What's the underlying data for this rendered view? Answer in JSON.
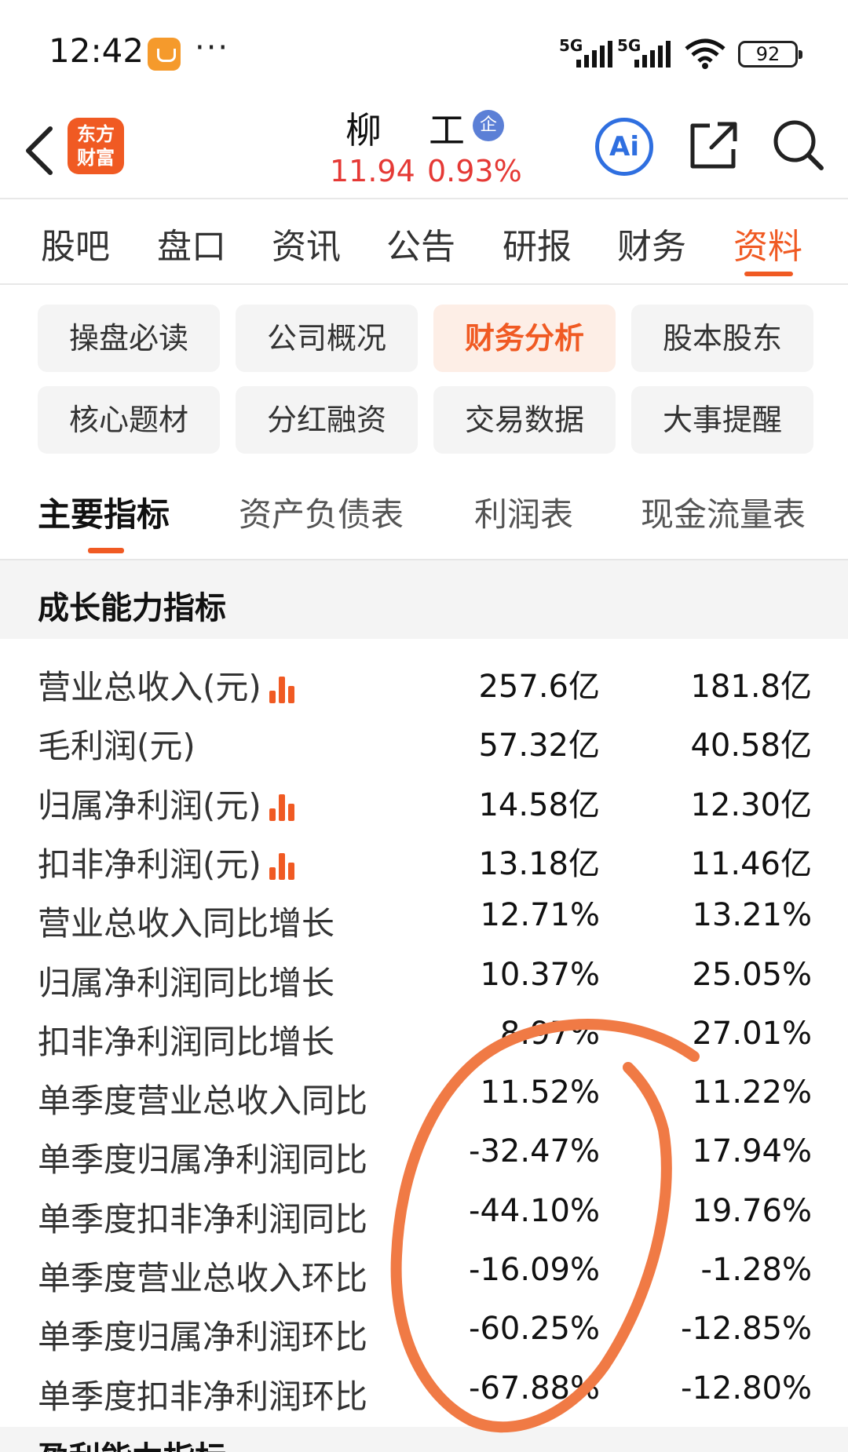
{
  "status_bar": {
    "time": "12:42",
    "more": "···",
    "network1": "5G",
    "network2": "5G",
    "battery": "92"
  },
  "header": {
    "logo_line1": "东方",
    "logo_line2": "财富",
    "stock_name": "柳工",
    "badge": "企",
    "price": "11.94",
    "change": "0.93%",
    "ai_label": "Ai"
  },
  "main_tabs": [
    {
      "label": "股吧"
    },
    {
      "label": "盘口"
    },
    {
      "label": "资讯"
    },
    {
      "label": "公告"
    },
    {
      "label": "研报"
    },
    {
      "label": "财务"
    },
    {
      "label": "资料",
      "active": true
    }
  ],
  "chips": [
    {
      "label": "操盘必读"
    },
    {
      "label": "公司概况"
    },
    {
      "label": "财务分析",
      "active": true
    },
    {
      "label": "股本股东"
    },
    {
      "label": "核心题材"
    },
    {
      "label": "分红融资"
    },
    {
      "label": "交易数据"
    },
    {
      "label": "大事提醒"
    }
  ],
  "sub_tabs": [
    {
      "label": "主要指标",
      "active": true
    },
    {
      "label": "资产负债表"
    },
    {
      "label": "利润表"
    },
    {
      "label": "现金流量表"
    }
  ],
  "section_title": "成长能力指标",
  "rows": [
    {
      "label": "营业总收入(元)",
      "chart": true,
      "v1": "257.6亿",
      "v2": "181.8亿"
    },
    {
      "label": "毛利润(元)",
      "chart": false,
      "v1": "57.32亿",
      "v2": "40.58亿"
    },
    {
      "label": "归属净利润(元)",
      "chart": true,
      "v1": "14.58亿",
      "v2": "12.30亿"
    },
    {
      "label": "扣非净利润(元)",
      "chart": true,
      "v1": "13.18亿",
      "v2": "11.46亿"
    },
    {
      "label": "营业总收入同比增长",
      "chart": false,
      "v1": "12.71%",
      "v2": "13.21%"
    },
    {
      "label": "归属净利润同比增长",
      "chart": false,
      "v1": "10.37%",
      "v2": "25.05%"
    },
    {
      "label": "扣非净利润同比增长",
      "chart": false,
      "v1": "8.97%",
      "v2": "27.01%"
    },
    {
      "label": "单季度营业总收入同比",
      "chart": false,
      "v1": "11.52%",
      "v2": "11.22%"
    },
    {
      "label": "单季度归属净利润同比",
      "chart": false,
      "v1": "-32.47%",
      "v2": "17.94%"
    },
    {
      "label": "单季度扣非净利润同比",
      "chart": false,
      "v1": "-44.10%",
      "v2": "19.76%"
    },
    {
      "label": "单季度营业总收入环比",
      "chart": false,
      "v1": "-16.09%",
      "v2": "-1.28%"
    },
    {
      "label": "单季度归属净利润环比",
      "chart": false,
      "v1": "-60.25%",
      "v2": "-12.85%"
    },
    {
      "label": "单季度扣非净利润环比",
      "chart": false,
      "v1": "-67.88%",
      "v2": "-12.80%"
    }
  ],
  "next_section_title": "盈利能力指标",
  "colors": {
    "accent": "#f05a23",
    "price": "#e53935",
    "annotation": "#f07a45",
    "ai": "#2f6fe0"
  }
}
